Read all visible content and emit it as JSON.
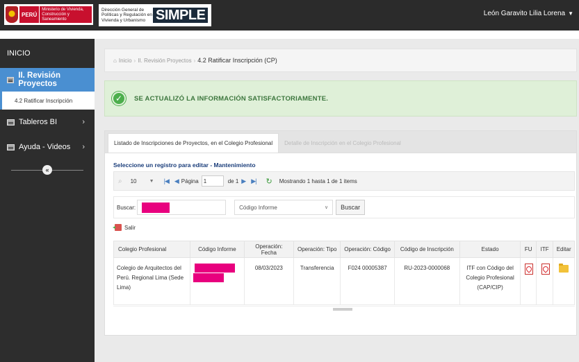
{
  "header": {
    "logo_peru": "PERÚ",
    "ministerio": "Ministerio de Vivienda, Construcción y Saneamiento",
    "direccion": "Dirección General de Políticas y Regulación en Vivienda y Urbanismo",
    "app_name": "SIMPLE",
    "user_name": "León Garavito Lilia Lorena"
  },
  "sidebar": {
    "inicio": "INICIO",
    "active_section": "II. Revisión Proyectos",
    "active_sub": "4.2 Ratificar Inscripción",
    "items": [
      {
        "label": "Tableros BI"
      },
      {
        "label": "Ayuda - Videos"
      }
    ]
  },
  "breadcrumb": {
    "home": "Inicio",
    "section": "II. Revisión Proyectos",
    "current": "4.2 Ratificar Inscripción (CP)"
  },
  "alert": {
    "message": "SE ACTUALIZÓ LA INFORMACIÓN SATISFACTORIAMENTE."
  },
  "tabs": [
    {
      "label": "Listado de Inscripciones de Proyectos, en el Colegio Profesional",
      "active": true
    },
    {
      "label": "Detalle de Inscripción en el Colegio Profesional",
      "active": false
    }
  ],
  "grid": {
    "title": "Seleccione un registro para editar - Mantenimiento",
    "page_size": "10",
    "page_label": "Página",
    "page_value": "1",
    "of_label": "de 1",
    "showing": "Mostrando 1 hasta 1 de 1 items",
    "search_label": "Buscar:",
    "search_field": "Código Informe",
    "search_button": "Buscar",
    "exit_label": "Salir",
    "columns": [
      "Colegio Profesional",
      "Código Informe",
      "Operación: Fecha",
      "Operación: Tipo",
      "Operación: Código",
      "Código de Inscripción",
      "Estado",
      "FU",
      "ITF",
      "Editar"
    ],
    "rows": [
      {
        "colegio": "Colegio de Arquitectos del Perú. Regional Lima (Sede Lima)",
        "fecha": "08/03/2023",
        "tipo": "Transferencia",
        "op_codigo": "F024 00005387",
        "cod_inscripcion": "RU-2023-0000068",
        "estado": "ITF con Código del Colegio Profesional (CAP/CIP)"
      }
    ]
  },
  "colors": {
    "accent": "#4a8fd1",
    "sidebar_bg": "#2d2d2d",
    "success_bg": "#dff0d8",
    "success_text": "#3c763d",
    "redaction": "#e8007e"
  }
}
